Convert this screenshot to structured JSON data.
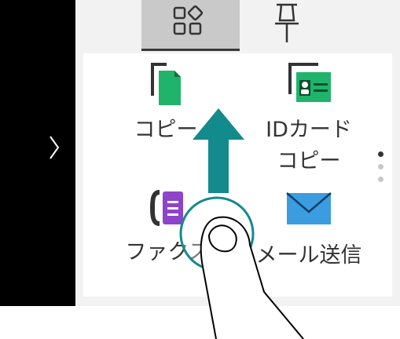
{
  "tabs": [
    {
      "name": "home-tab",
      "icon": "grid-diamond-icon",
      "selected": true
    },
    {
      "name": "pin-tab",
      "icon": "pin-icon",
      "selected": false
    }
  ],
  "tiles": [
    {
      "label": "コピー",
      "icon": "copy-icon"
    },
    {
      "label_line1": "IDカード",
      "label_line2": "コピー",
      "icon": "id-card-copy-icon"
    },
    {
      "label": "ファクス",
      "icon": "fax-icon"
    },
    {
      "label": "メール送信",
      "icon": "email-icon"
    }
  ],
  "pager": {
    "pages": 3,
    "current": 1
  },
  "gesture": {
    "type": "swipe-up",
    "icon": "finger-swipe-up-icon"
  },
  "colors": {
    "accent_teal": "#138a8c",
    "copy_green": "#1fb46a",
    "fax_purple": "#8e44c9",
    "mail_blue": "#3b9ce0"
  }
}
